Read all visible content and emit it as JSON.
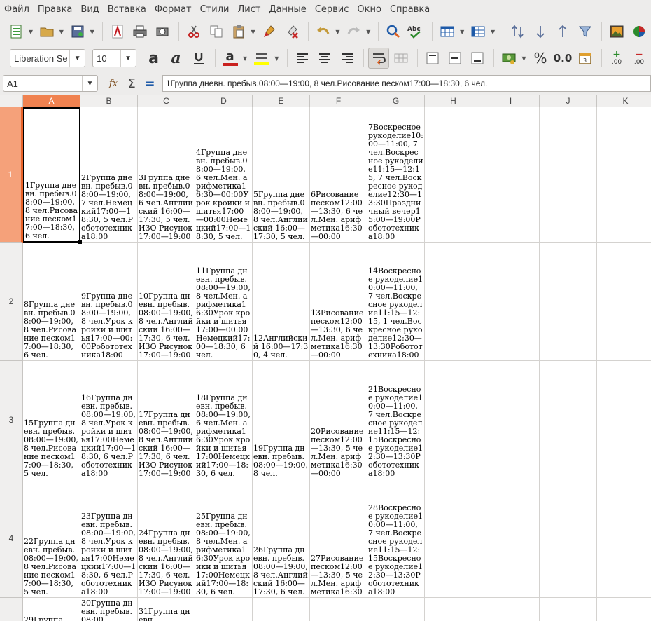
{
  "menu": [
    "Файл",
    "Правка",
    "Вид",
    "Вставка",
    "Формат",
    "Стили",
    "Лист",
    "Данные",
    "Сервис",
    "Окно",
    "Справка"
  ],
  "toolbar": {
    "font_name": "Liberation Se",
    "font_size": "10",
    "percent_label": "%",
    "number_label": "0.0",
    "bold_label": "a",
    "italic_label": "a",
    "fontcolor_label": "a",
    "plus_label": "+",
    "minus_label": "−",
    "zeros_label": ".00",
    "spell_label": "Abc"
  },
  "formula_bar": {
    "cell_ref": "A1",
    "fx": "fx",
    "sigma": "Σ",
    "equals": "=",
    "content": "1Группа дневн. пребыв.08:00—19:00, 8 чел.Рисование песком17:00—18:30, 6 чел."
  },
  "columns": [
    "A",
    "B",
    "C",
    "D",
    "E",
    "F",
    "G",
    "H",
    "I",
    "J",
    "K"
  ],
  "rows": [
    {
      "label": "1",
      "cells": [
        "1Группа дневн. пребыв.08:00—19:00, 8 чел.Рисование песком17:00—18:30, 6 чел.",
        "2Группа дневн. пребыв.08:00—19:00, 7 чел.Немецкий17:00—18:30, 5 чел.Робототехника18:00",
        "3Группа дневн. пребыв.08:00—19:00, 6 чел.Английский 16:00—17:30, 5 чел.ИЗО Рисунок17:00—19:00",
        "4Группа дневн. пребыв.08:00—19:00, 6 чел.Мен. арифметика16:30—00:00Урок кройки и шитья17:00—00:00Немецкий17:00—18:30, 5 чел.",
        "5Группа дневн. пребыв.08:00—19:00, 8 чел.Английский 16:00—17:30, 5 чел.",
        "6Рисование песком12:00—13:30, 6 чел.Мен. арифметика16:30—00:00",
        "7Воскресное рукоделие10:00—11:00, 7 чел.Воскресное рукоделие11:15—12:15, 7 чел.Воскресное рукоделие12:30—13:30Праздничный вечер15:00—19:00Робототехника18:00",
        "",
        "",
        "",
        ""
      ]
    },
    {
      "label": "2",
      "cells": [
        "8Группа дневн. пребыв.08:00—19:00, 8 чел.Рисование песком17:00—18:30, 6 чел.",
        "9Группа дневн. пребыв.08:00—19:00, 8 чел.Урок кройки и шитья17:00—00:00Робототехника18:00",
        "10Группа дневн. пребыв.08:00—19:00, 8 чел.Английский 16:00—17:30, 6 чел.ИЗО Рисунок17:00—19:00",
        "11Группа дневн. пребыв.08:00—19:00, 8 чел.Мен. арифметика16:30Урок кройки и шитья17:00—00:00Немецкий17:00—18:30, 6 чел.",
        "12Английский 16:00—17:30, 4 чел.",
        "13Рисование песком12:00—13:30, 6 чел.Мен. арифметика16:30—00:00",
        "14Воскресное рукоделие10:00—11:00, 7 чел.Воскресное рукоделие11:15—12:15, 1 чел.Воскресное рукоделие12:30—13:30Робототехника18:00",
        "",
        "",
        "",
        ""
      ]
    },
    {
      "label": "3",
      "cells": [
        "15Группа дневн. пребыв.08:00—19:00, 8 чел.Рисование песком17:00—18:30, 5 чел.",
        "16Группа дневн. пребыв.08:00—19:00, 8 чел.Урок кройки и шитья17:00Немецкий17:00—18:30, 6 чел.Робототехника18:00",
        "17Группа дневн. пребыв.08:00—19:00, 8 чел.Английский 16:00—17:30, 6 чел.ИЗО Рисунок17:00—19:00",
        "18Группа дневн. пребыв.08:00—19:00, 6 чел.Мен. арифметика16:30Урок кройки и шитья17:00Немецкий17:00—18:30, 6 чел.",
        "19Группа дневн. пребыв.08:00—19:00, 8 чел.",
        "20Рисование песком12:00—13:30, 5 чел.Мен. арифметика16:30—00:00",
        "21Воскресное рукоделие10:00—11:00, 7 чел.Воскресное рукоделие11:15—12:15Воскресное рукоделие12:30—13:30Робототехника18:00",
        "",
        "",
        "",
        ""
      ]
    },
    {
      "label": "4",
      "cells": [
        "22Группа дневн. пребыв.08:00—19:00, 8 чел.Рисование песком17:00—18:30, 5 чел.",
        "23Группа дневн. пребыв.08:00—19:00, 8 чел.Урок кройки и шитья17:00Немецкий17:00—18:30, 6 чел.Робототехника18:00",
        "24Группа дневн. пребыв.08:00—19:00, 8 чел.Английский 16:00—17:30, 6 чел.ИЗО Рисунок17:00—19:00",
        "25Группа дневн. пребыв.08:00—19:00, 8 чел.Мен. арифметика16:30Урок кройки и шитья17:00Немецкий17:00—18:30, 6 чел.",
        "26Группа дневн. пребыв.08:00—19:00, 8 чел.Английский 16:00—17:30, 6 чел.",
        "27Рисование песком12:00—13:30, 5 чел.Мен. арифметика16:30",
        "28Воскресное рукоделие10:00—11:00, 7 чел.Воскресное рукоделие11:15—12:15Воскресное рукоделие12:30—13:30Робототехника18:00",
        "",
        "",
        "",
        ""
      ]
    },
    {
      "label": "",
      "cells": [
        "29Группа",
        "30Группа дневн. пребыв.08:00",
        "31Группа дневн.",
        "",
        "",
        "",
        "",
        "",
        "",
        "",
        ""
      ]
    }
  ]
}
